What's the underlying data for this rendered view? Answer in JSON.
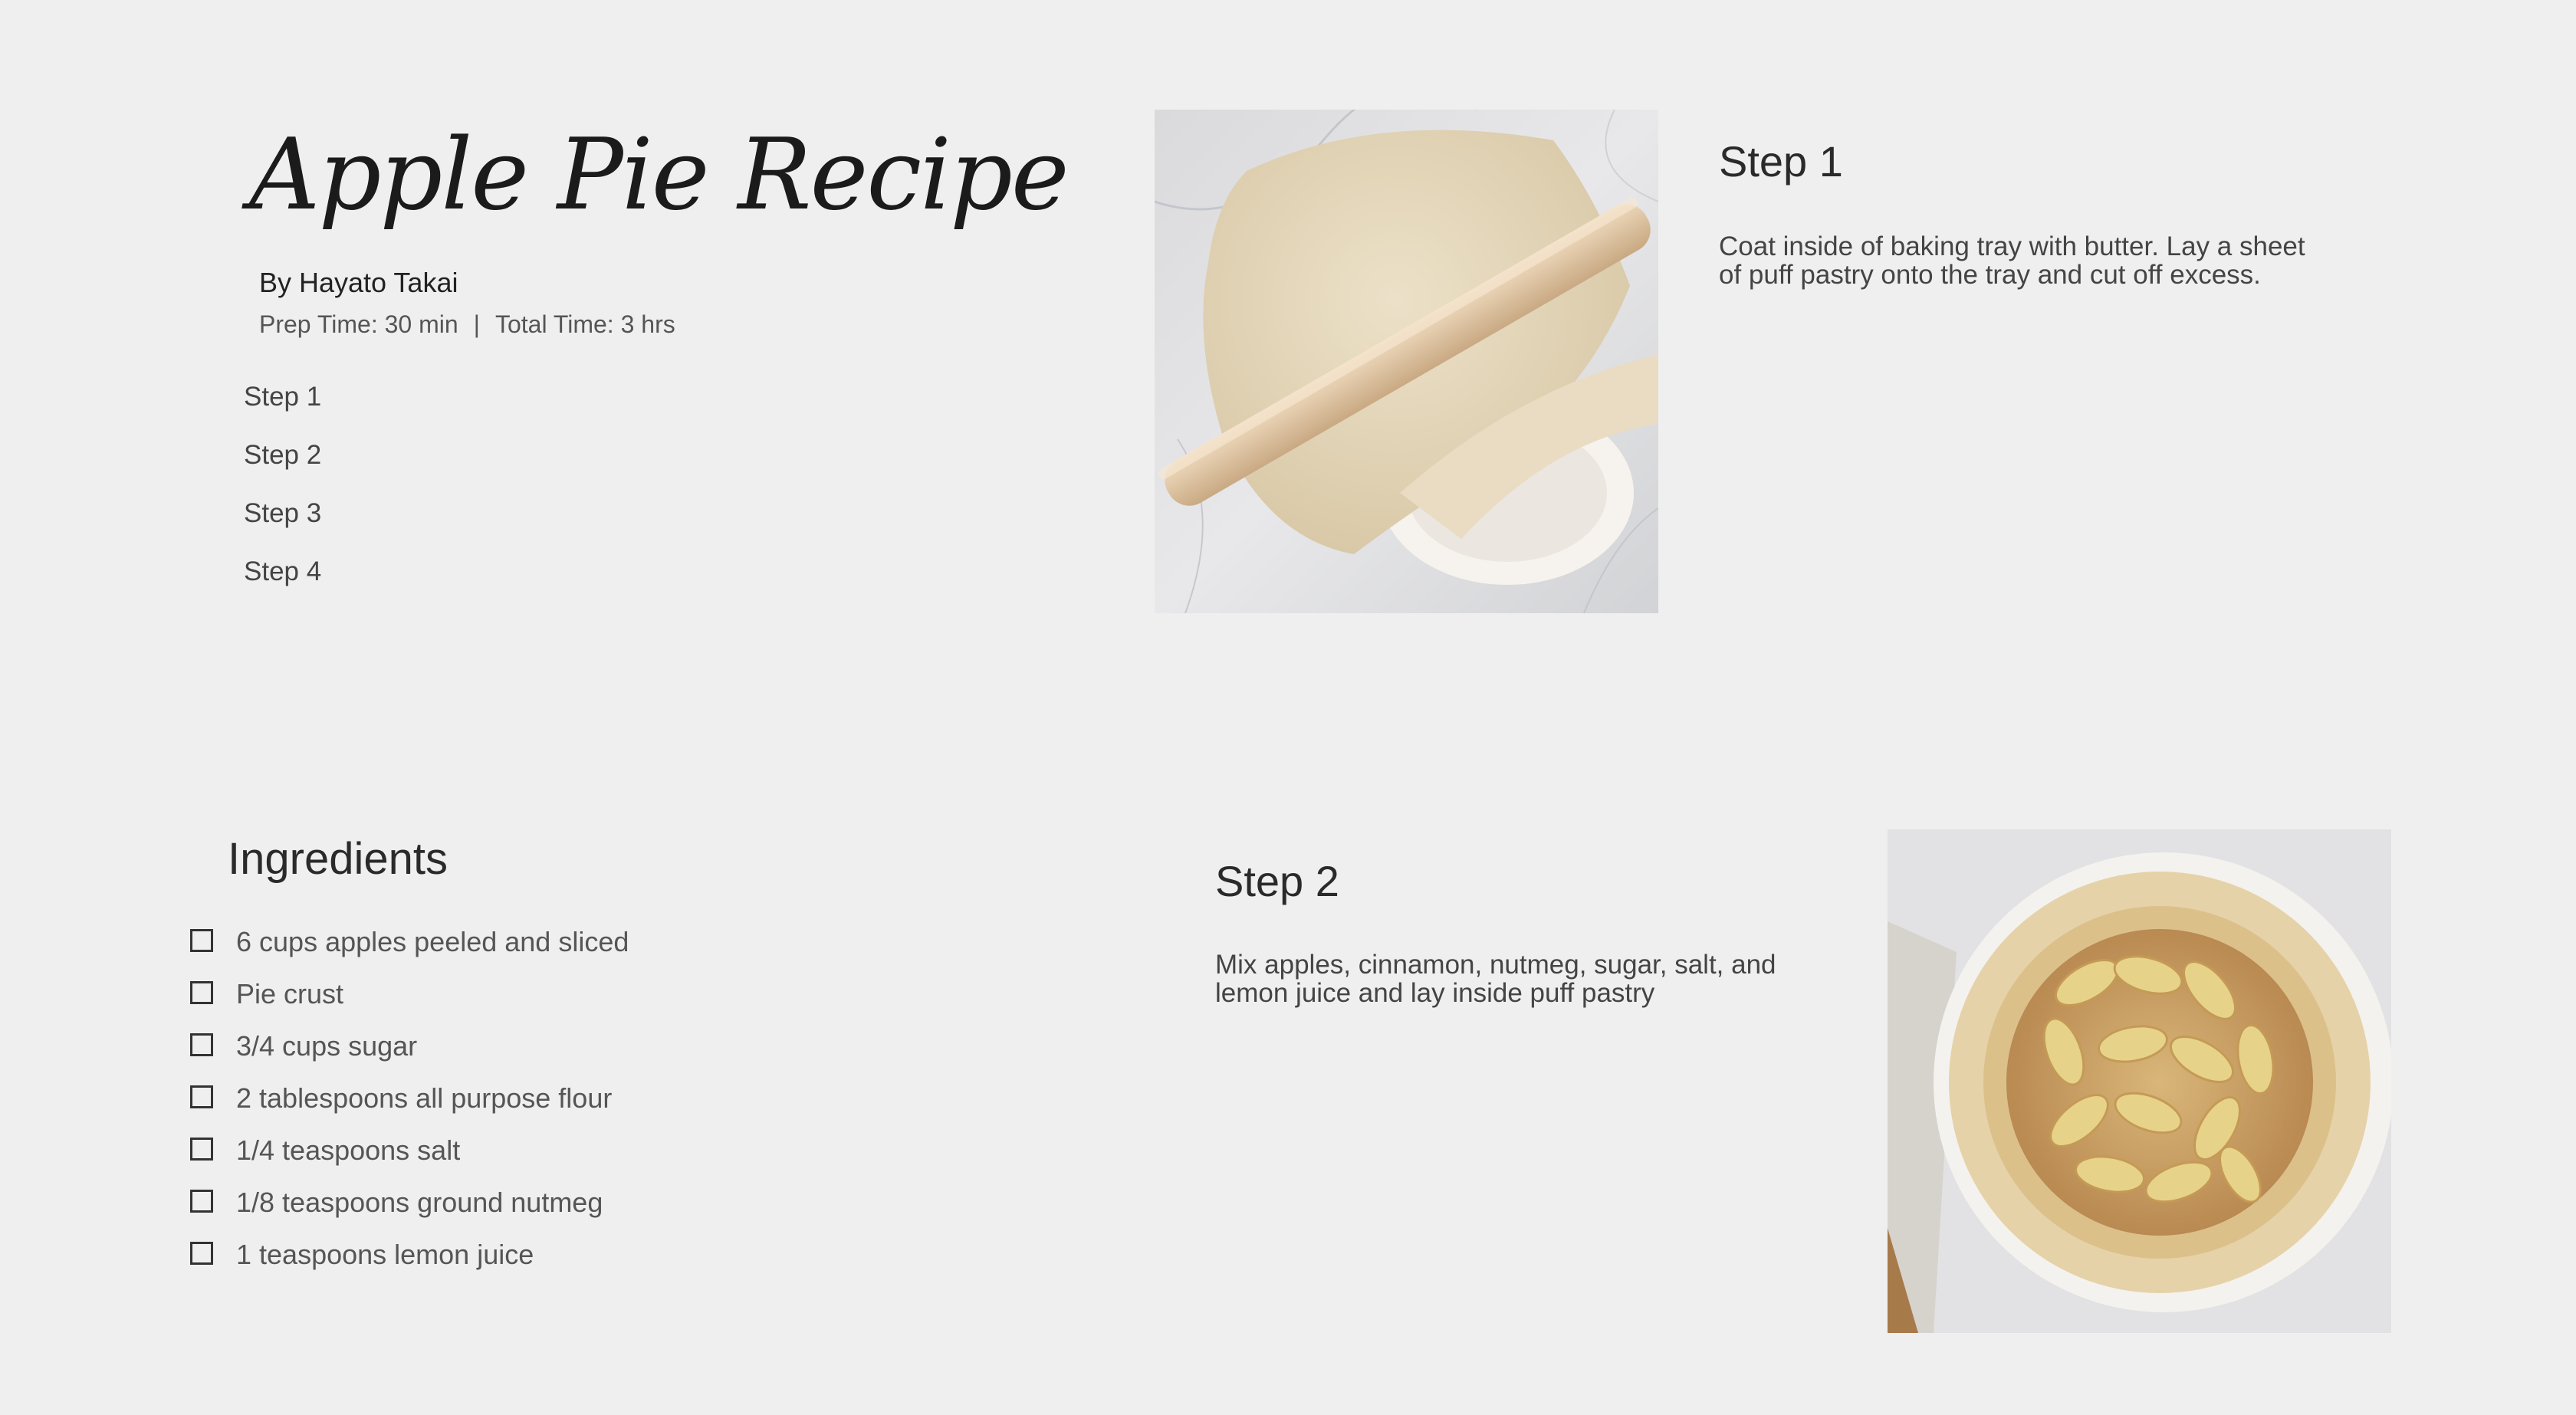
{
  "header": {
    "title": "Apple Pie Recipe",
    "author": "By Hayato Takai",
    "prep_time": "Prep Time: 30 min",
    "separator": "|",
    "total_time": "Total Time: 3 hrs"
  },
  "step_nav": [
    {
      "label": "Step 1"
    },
    {
      "label": "Step 2"
    },
    {
      "label": "Step 3"
    },
    {
      "label": "Step 4"
    }
  ],
  "steps": [
    {
      "heading": "Step 1",
      "text": "Coat inside of baking tray with butter. Lay a sheet of puff pastry onto the tray and cut off excess."
    },
    {
      "heading": "Step 2",
      "text": "Mix apples, cinnamon, nutmeg, sugar, salt, and lemon juice and lay inside puff pastry"
    }
  ],
  "ingredients": {
    "heading": "Ingredients",
    "items": [
      {
        "label": "6 cups apples peeled and sliced",
        "checked": false
      },
      {
        "label": "Pie crust",
        "checked": false
      },
      {
        "label": "3/4 cups sugar",
        "checked": false
      },
      {
        "label": "2 tablespoons all purpose flour",
        "checked": false
      },
      {
        "label": "1/4 teaspoons salt",
        "checked": false
      },
      {
        "label": "1/8 teaspoons ground nutmeg",
        "checked": false
      },
      {
        "label": "1 teaspoons lemon juice",
        "checked": false
      }
    ]
  },
  "colors": {
    "background": "#efefef",
    "text": "#3a3a3a",
    "title": "#1b1b1b"
  }
}
